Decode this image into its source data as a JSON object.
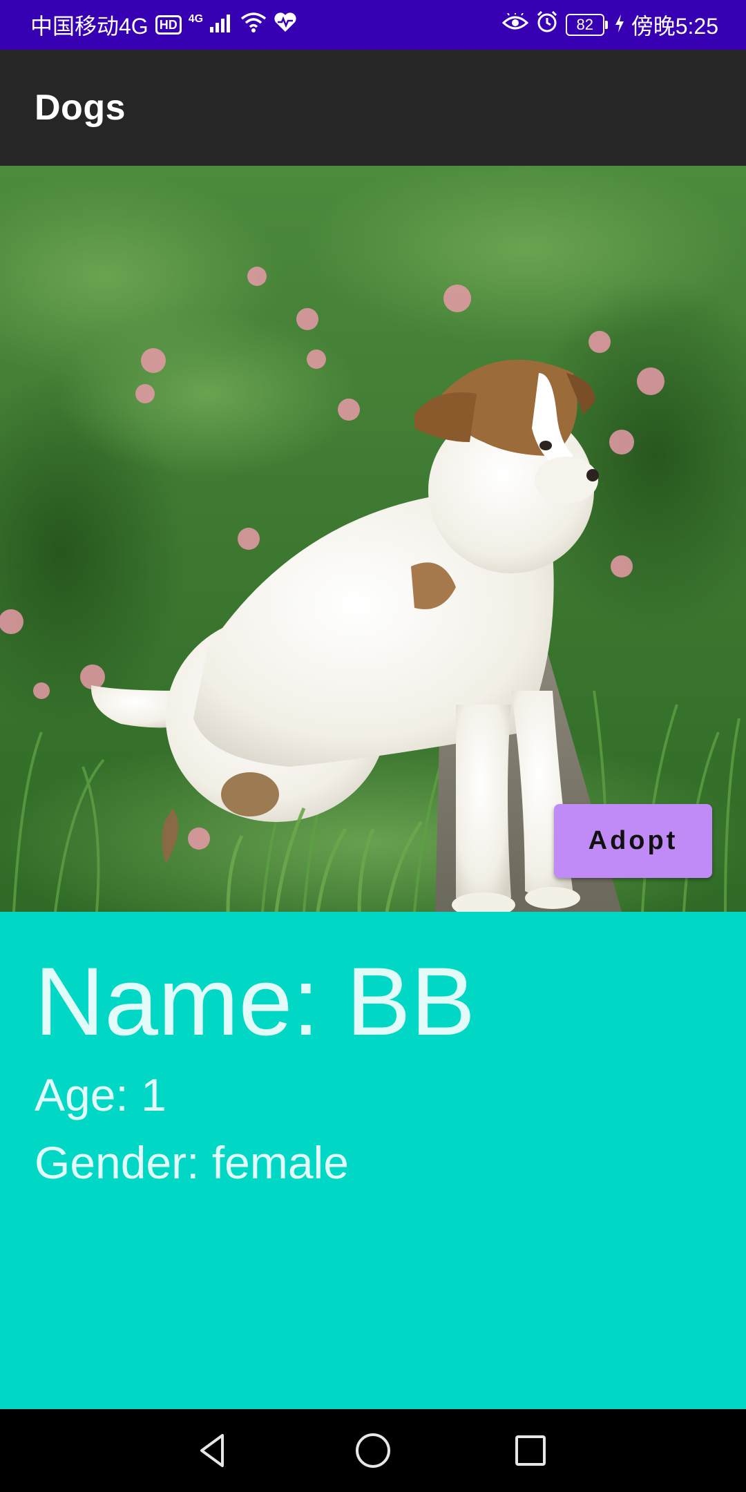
{
  "status_bar": {
    "carrier": "中国移动4G",
    "hd": "HD",
    "network": "4G",
    "battery": "82",
    "time": "傍晚5:25"
  },
  "app_bar": {
    "title": "Dogs"
  },
  "hero": {
    "image_subject": "puppy",
    "adopt_label": "Adopt"
  },
  "dog": {
    "name": "Name: BB",
    "age": "Age: 1",
    "gender": "Gender: female"
  },
  "nav_bar": {
    "icons": [
      "back-icon",
      "home-icon",
      "recents-icon"
    ]
  },
  "colors": {
    "status_bar": "#3700b3",
    "app_bar": "#262626",
    "info_background": "#00d7c4",
    "adopt_button": "#c08bf7"
  }
}
